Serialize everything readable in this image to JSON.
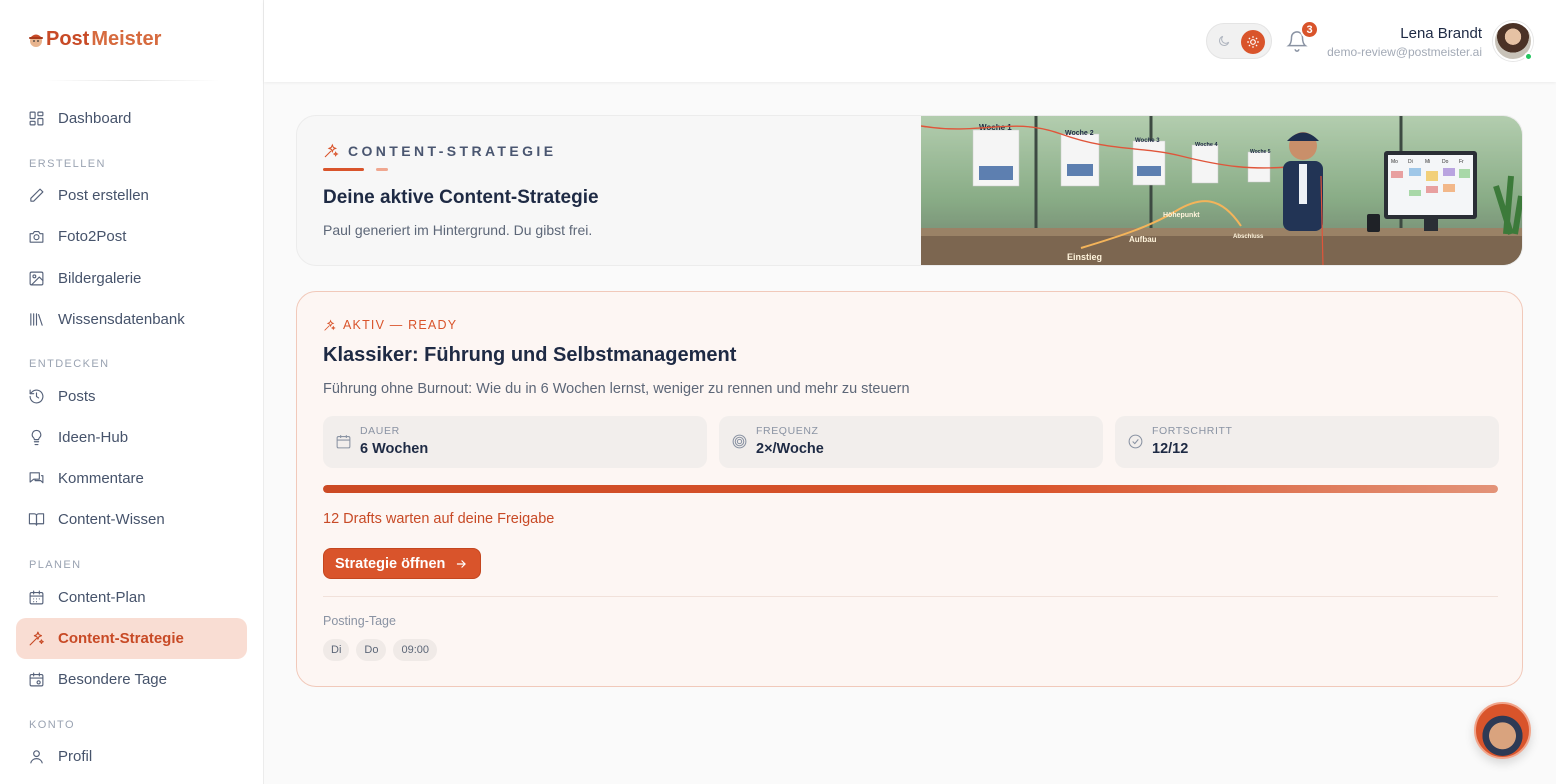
{
  "app": {
    "logo_part1": "Post",
    "logo_part2": "Meister"
  },
  "sidebar": {
    "dashboard": "Dashboard",
    "sections": {
      "erstellen": "ERSTELLEN",
      "entdecken": "ENTDECKEN",
      "planen": "PLANEN",
      "konto": "KONTO"
    },
    "items": {
      "post_erstellen": "Post erstellen",
      "foto2post": "Foto2Post",
      "bildergalerie": "Bildergalerie",
      "wissensdatenbank": "Wissensdatenbank",
      "posts": "Posts",
      "ideen_hub": "Ideen-Hub",
      "kommentare": "Kommentare",
      "content_wissen": "Content-Wissen",
      "content_plan": "Content-Plan",
      "content_strategie": "Content-Strategie",
      "besondere_tage": "Besondere Tage",
      "profil": "Profil"
    },
    "active_item": "Content-Strategie"
  },
  "header": {
    "notifications_count": "3",
    "user_name": "Lena Brandt",
    "user_email": "demo-review@postmeister.ai",
    "theme": "light"
  },
  "hero": {
    "kicker": "CONTENT-STRATEGIE",
    "title": "Deine aktive Content-Strategie",
    "subtitle": "Paul generiert im Hintergrund. Du gibst frei.",
    "image_labels": {
      "weeks": [
        "Woche 1",
        "Woche 2",
        "Woche 3",
        "Woche 4",
        "Woche 5"
      ],
      "phases": [
        "Einstieg",
        "Aufbau",
        "Höhepunkt",
        "Abschluss"
      ],
      "weekdays": [
        "Mo",
        "Di",
        "Mi",
        "Do",
        "Fr"
      ]
    }
  },
  "strategy": {
    "status": "AKTIV — READY",
    "title": "Klassiker: Führung und Selbstmanagement",
    "subtitle": "Führung ohne Burnout: Wie du in 6 Wochen lernst, weniger zu rennen und mehr zu steuern",
    "stats": {
      "duration": {
        "label": "DAUER",
        "value": "6 Wochen"
      },
      "frequency": {
        "label": "FREQUENZ",
        "value": "2×/Woche"
      },
      "progress": {
        "label": "FORTSCHRITT",
        "value": "12/12"
      }
    },
    "progress_fraction": 1.0,
    "drafts_message": "12 Drafts warten auf deine Freigabe",
    "open_button": "Strategie öffnen",
    "posting_days_label": "Posting-Tage",
    "posting_chips": [
      "Di",
      "Do",
      "09:00"
    ]
  },
  "colors": {
    "accent": "#d9542b",
    "accent_dark": "#c84a26",
    "active_bg": "#f9ddd3",
    "text_primary": "#1e2a44",
    "text_muted": "#5d6778",
    "online": "#22c55e"
  },
  "icons": {
    "dashboard": "grid-icon",
    "post_erstellen": "pencil-icon",
    "foto2post": "camera-icon",
    "bildergalerie": "image-icon",
    "wissensdatenbank": "library-icon",
    "posts": "history-icon",
    "ideen_hub": "lightbulb-icon",
    "kommentare": "comments-icon",
    "content_wissen": "book-open-icon",
    "content_plan": "calendar-icon",
    "content_strategie": "sparkles-icon",
    "besondere_tage": "calendar-star-icon",
    "profil": "user-icon"
  }
}
